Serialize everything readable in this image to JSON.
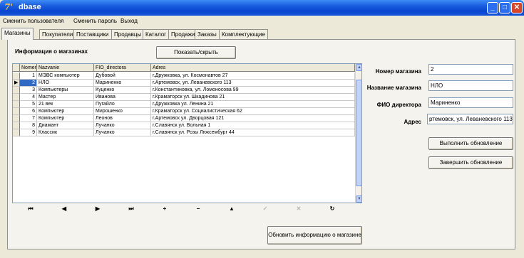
{
  "window": {
    "title": "dbase",
    "icon": "dbase-app-icon"
  },
  "menu": [
    "Сменить пользователя",
    "Сменить пароль",
    "Выход"
  ],
  "tabs": [
    "Магазины",
    "Покупатели",
    "Поставщики",
    "Продавцы",
    "Каталог",
    "Продажи",
    "Заказы",
    "Комплектующие"
  ],
  "active_tab": "Магазины",
  "panel": {
    "title": "Информация о магазинах",
    "toggle_button": "Показать/скрыть",
    "refresh_button": "Обновить информацию о магазине"
  },
  "grid": {
    "columns": [
      "Nomer",
      "Nazvanie",
      "FIO_directora",
      "Adres"
    ],
    "rows": [
      [
        "1",
        "МЭВС компьютер",
        "Дубовой",
        "г.Дружковка, ул. Космонавтов 27"
      ],
      [
        "2",
        "НЛО",
        "Мариненко",
        "г.Артемовск, ул. Леваневского 113"
      ],
      [
        "3",
        "Компьютеры",
        "Куценко",
        "г.Константиновка, ул. Ломоносова 99"
      ],
      [
        "4",
        "Мастер",
        "Иванова",
        "г.Краматорск ул. Шкадинова 21"
      ],
      [
        "5",
        "21 век",
        "Пугайло",
        "г.Дружковка ул. Ленина 21"
      ],
      [
        "6",
        "Компьютер",
        "Мирошенко",
        "г.Краматорск ул. Социалистическая 62"
      ],
      [
        "7",
        "Компьютер",
        "Леонов",
        "г.Артемовск ул. Дворцовая 121"
      ],
      [
        "8",
        "Диамант",
        "Лучанко",
        "г.Славянск ул. Вольная 1"
      ],
      [
        "9",
        "Классик",
        "Лучанко",
        "г.Славянск ул. Розы Люксембург 44"
      ]
    ],
    "selected_row": 2
  },
  "navigator": [
    {
      "name": "first-record",
      "glyph": "⏮",
      "enabled": true
    },
    {
      "name": "prior-record",
      "glyph": "◀",
      "enabled": true
    },
    {
      "name": "next-record",
      "glyph": "▶",
      "enabled": true
    },
    {
      "name": "last-record",
      "glyph": "⏭",
      "enabled": true
    },
    {
      "name": "insert-record",
      "glyph": "+",
      "enabled": true
    },
    {
      "name": "delete-record",
      "glyph": "−",
      "enabled": true
    },
    {
      "name": "edit-record",
      "glyph": "▲",
      "enabled": true
    },
    {
      "name": "post-edit",
      "glyph": "✓",
      "enabled": false
    },
    {
      "name": "cancel-edit",
      "glyph": "✕",
      "enabled": false
    },
    {
      "name": "refresh-data",
      "glyph": "↻",
      "enabled": true
    }
  ],
  "form": {
    "number_label": "Номер магазина",
    "number_value": "2",
    "name_label": "Название магазина",
    "name_value": "НЛО",
    "director_label": "ФИО директора",
    "director_value": "Мариненко",
    "address_label": "Адрес",
    "address_value": "ртемовск, ул. Леваневского 113",
    "update_button": "Выполнить обновление",
    "finish_button": "Завершить обновление"
  }
}
